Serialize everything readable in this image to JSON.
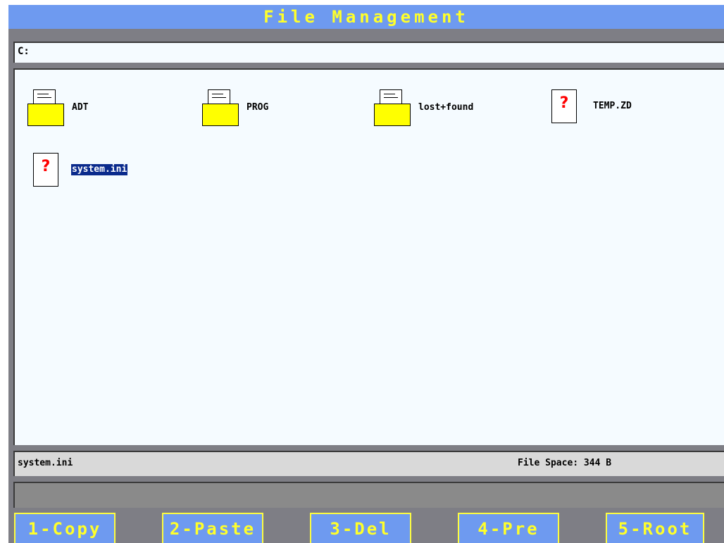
{
  "window": {
    "title": "File Management"
  },
  "path": {
    "value": "C:"
  },
  "files": [
    {
      "name": "ADT",
      "type": "folder",
      "selected": false
    },
    {
      "name": "PROG",
      "type": "folder",
      "selected": false
    },
    {
      "name": "lost+found",
      "type": "folder",
      "selected": false
    },
    {
      "name": "TEMP.ZD",
      "type": "unknown-file",
      "selected": false
    },
    {
      "name": "system.ini",
      "type": "unknown-file",
      "selected": true
    }
  ],
  "status": {
    "selected_name": "system.ini",
    "file_space": "File Space: 344 B"
  },
  "message": "",
  "function_keys": [
    {
      "label": "1-Copy"
    },
    {
      "label": "2-Paste"
    },
    {
      "label": "3-Del"
    },
    {
      "label": "4-Pre"
    },
    {
      "label": "5-Root"
    }
  ],
  "colors": {
    "title_bar": "#6e9af0",
    "title_text": "#ffff2a",
    "folder": "#ffff00",
    "unknown_mark": "#ff0000",
    "selection": "#0a2a8c",
    "frame": "#7e7e85"
  },
  "icons": {
    "folder": "folder-icon",
    "unknown_file": "unknown-file-icon"
  }
}
